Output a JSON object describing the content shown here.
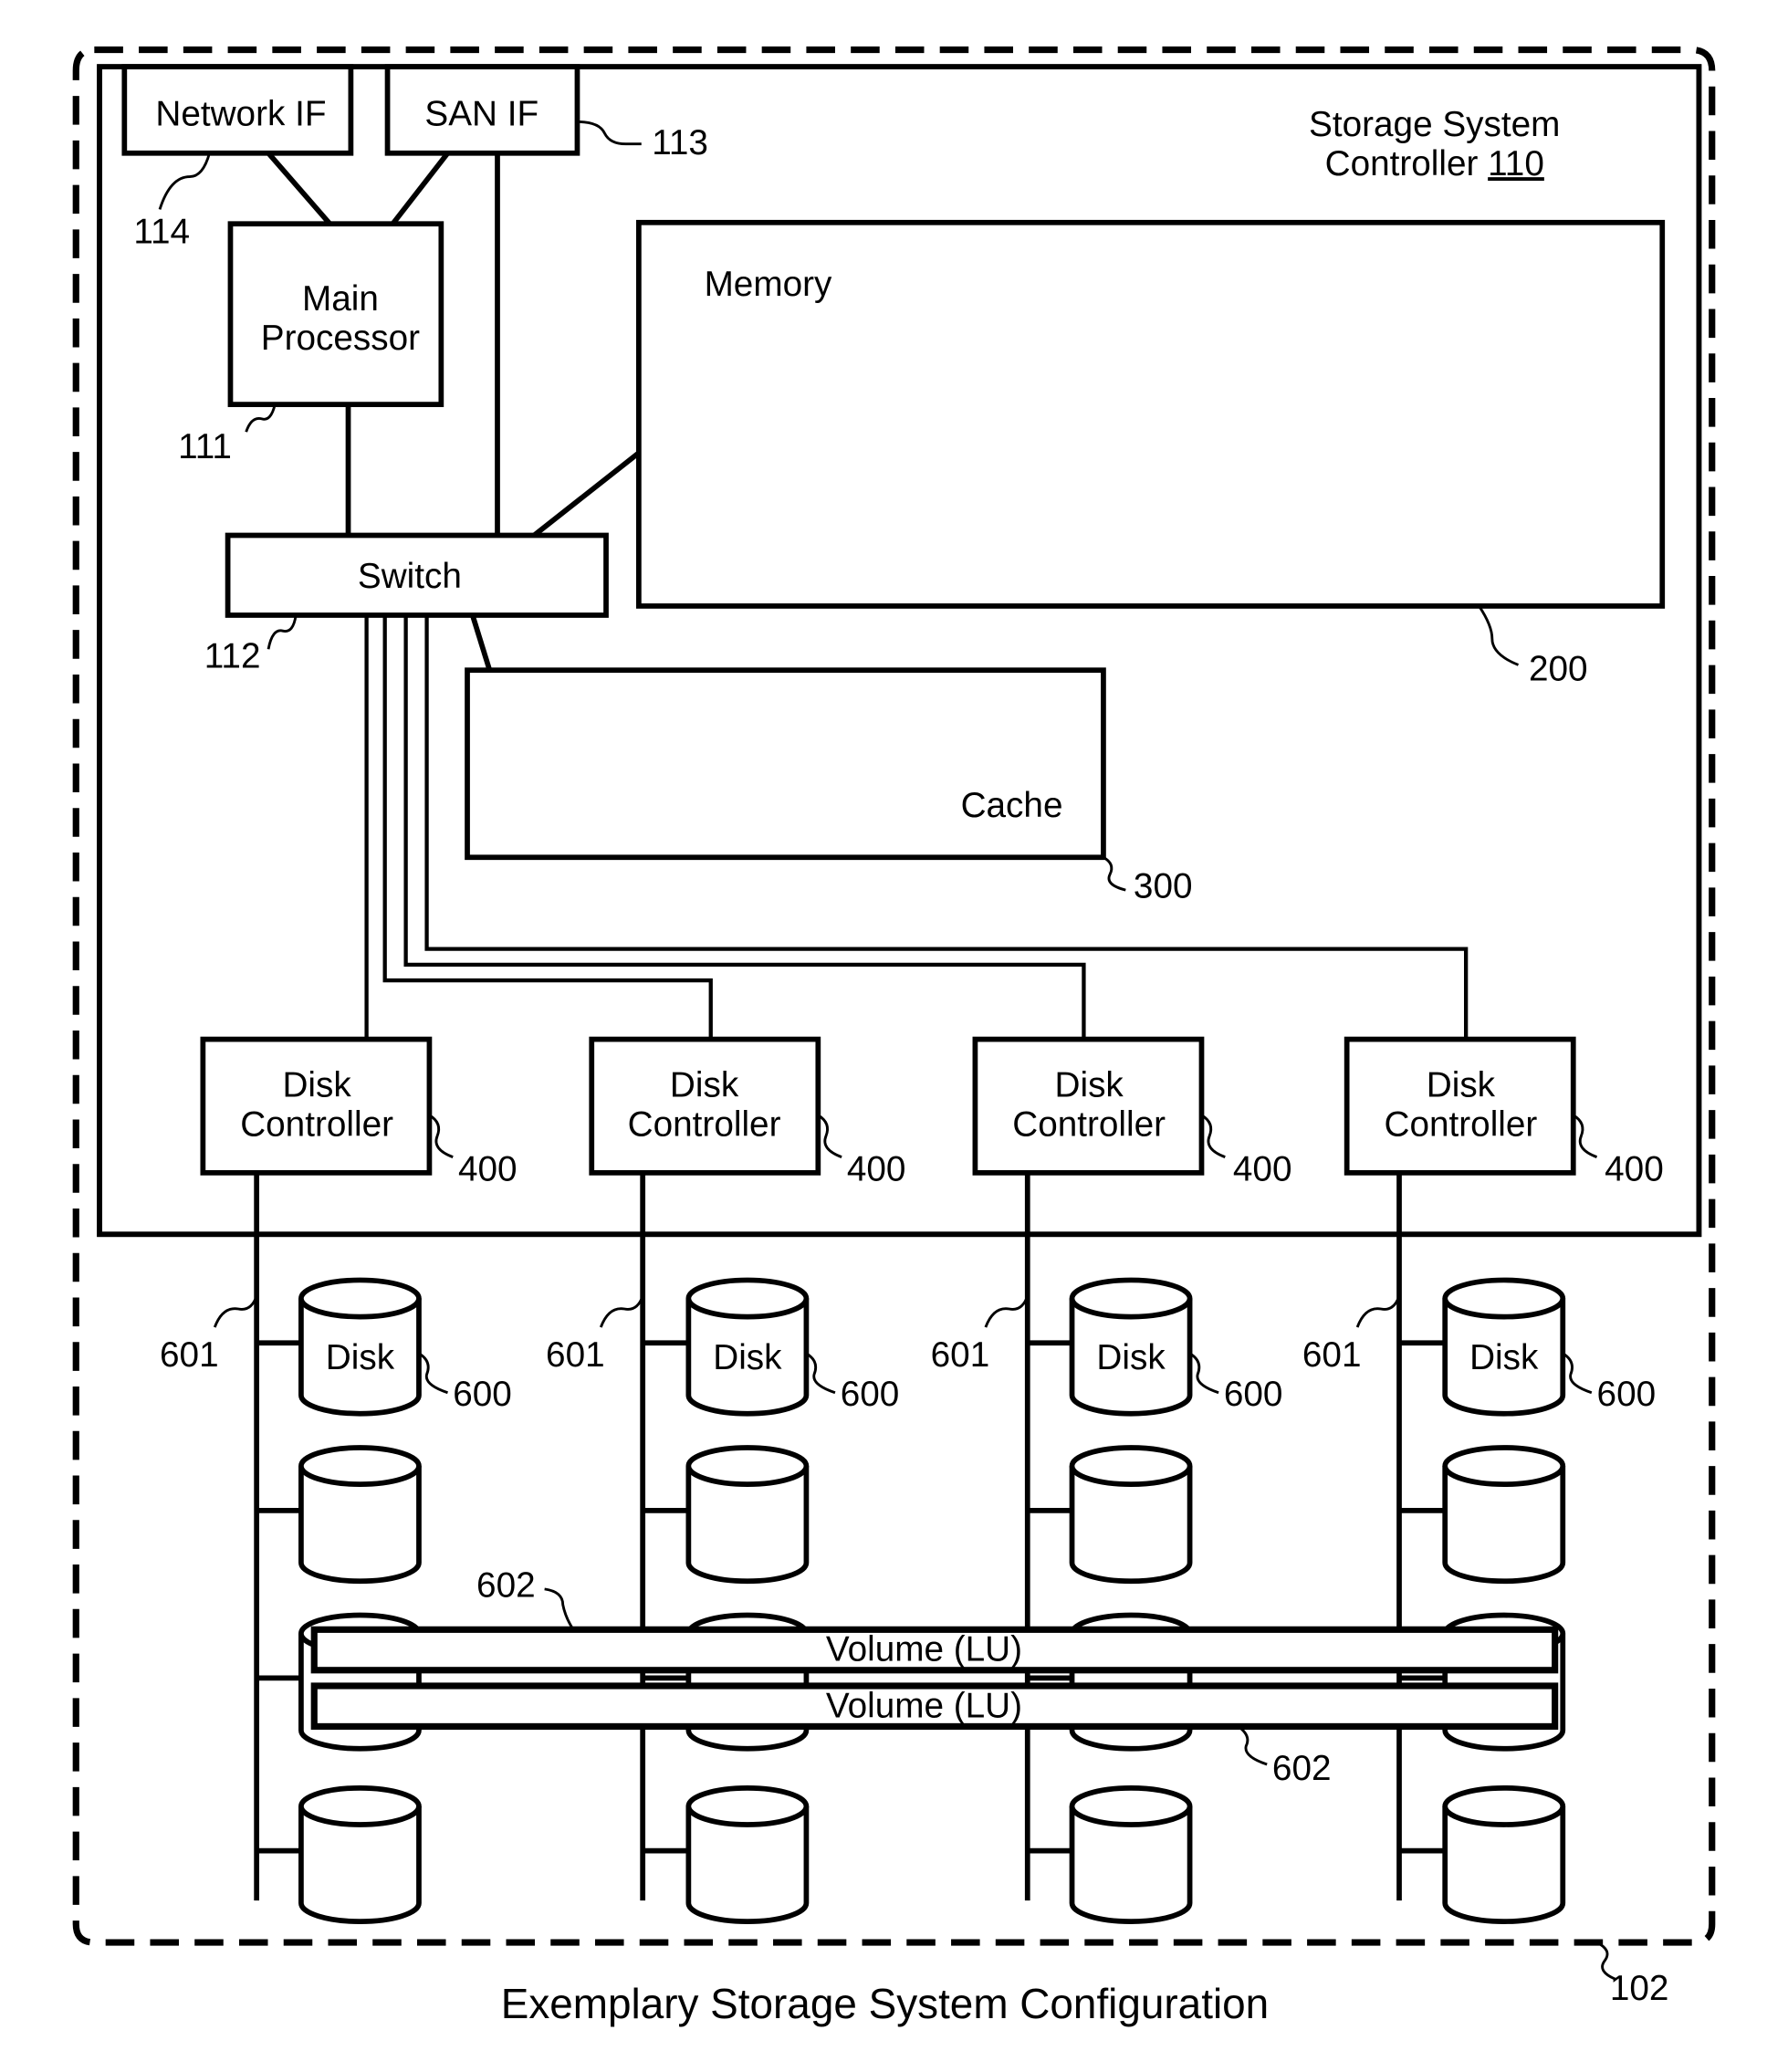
{
  "figure": {
    "caption": "Exemplary Storage System Configuration",
    "system_ref": "102"
  },
  "controller": {
    "title_line1": "Storage System",
    "title_line2_prefix": "Controller ",
    "ref": "110"
  },
  "components": {
    "network_if": {
      "label": "Network IF",
      "ref": "114"
    },
    "san_if": {
      "label": "SAN IF",
      "ref": "113"
    },
    "main_processor": {
      "label_line1": "Main",
      "label_line2": "Processor",
      "ref": "111"
    },
    "switch": {
      "label": "Switch",
      "ref": "112"
    },
    "memory": {
      "label": "Memory",
      "ref": "200"
    },
    "cache": {
      "label": "Cache",
      "ref": "300"
    }
  },
  "disk_controllers": [
    {
      "label_line1": "Disk",
      "label_line2": "Controller",
      "ref": "400"
    },
    {
      "label_line1": "Disk",
      "label_line2": "Controller",
      "ref": "400"
    },
    {
      "label_line1": "Disk",
      "label_line2": "Controller",
      "ref": "400"
    },
    {
      "label_line1": "Disk",
      "label_line2": "Controller",
      "ref": "400"
    }
  ],
  "disk_columns": [
    {
      "bus_ref": "601",
      "disk_label": "Disk",
      "disk_ref": "600"
    },
    {
      "bus_ref": "601",
      "disk_label": "Disk",
      "disk_ref": "600"
    },
    {
      "bus_ref": "601",
      "disk_label": "Disk",
      "disk_ref": "600"
    },
    {
      "bus_ref": "601",
      "disk_label": "Disk",
      "disk_ref": "600"
    }
  ],
  "volumes": [
    {
      "label": "Volume (LU)",
      "ref": "602"
    },
    {
      "label": "Volume (LU)",
      "ref": "602"
    }
  ]
}
